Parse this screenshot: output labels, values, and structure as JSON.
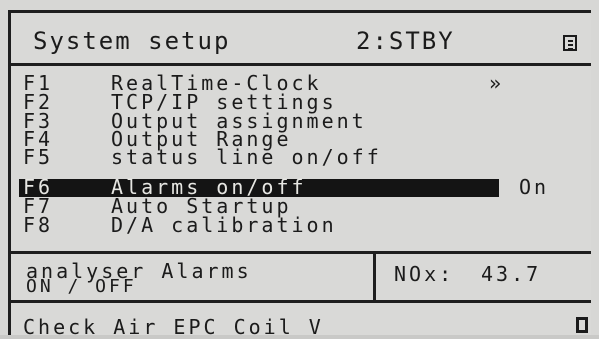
{
  "header": {
    "title": "System setup",
    "mode": "2:STBY",
    "menu_icon": "list-icon"
  },
  "menu": {
    "items": [
      {
        "key": "F1",
        "label": "RealTime-Clock",
        "extra": "»",
        "value": ""
      },
      {
        "key": "F2",
        "label": "TCP/IP settings",
        "extra": "",
        "value": ""
      },
      {
        "key": "F3",
        "label": "Output assignment",
        "extra": "",
        "value": ""
      },
      {
        "key": "F4",
        "label": "Output Range",
        "extra": "",
        "value": ""
      },
      {
        "key": "F5",
        "label": "status line on/off",
        "extra": "",
        "value": ""
      },
      {
        "key": "F6",
        "label": "Alarms on/off",
        "extra": "",
        "value": "On"
      },
      {
        "key": "F7",
        "label": "Auto Startup",
        "extra": "",
        "value": ""
      },
      {
        "key": "F8",
        "label": "D/A calibration",
        "extra": "",
        "value": ""
      }
    ],
    "selected_index": 5
  },
  "info": {
    "title": "analyser Alarms",
    "subtitle": "ON / OFF",
    "nox_label": "NOx:",
    "nox_value": "43.7"
  },
  "status": {
    "text": "Check Air EPC Coil V"
  },
  "colors": {
    "background": "#d9d9d7",
    "foreground": "#1b1b1b",
    "highlight": "#141414"
  }
}
